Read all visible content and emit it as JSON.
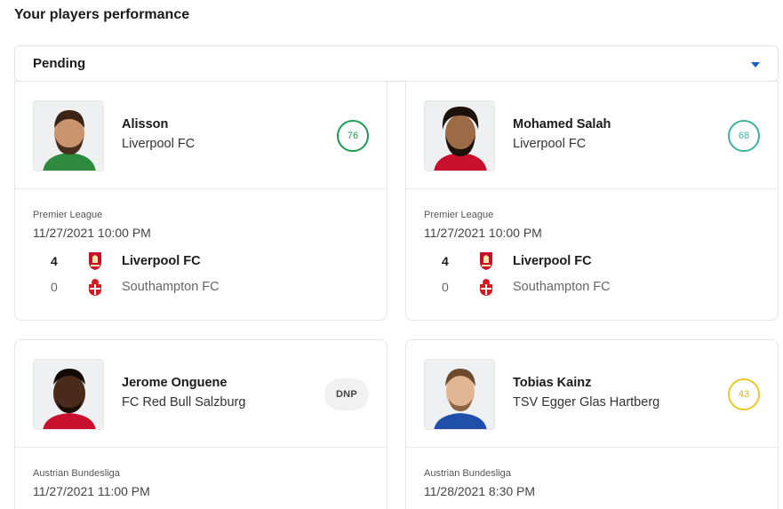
{
  "header": {
    "title": "Your players performance"
  },
  "filter": {
    "selected": "Pending"
  },
  "cards": [
    {
      "player": "Alisson",
      "club": "Liverpool FC",
      "score": "76",
      "league": "Premier League",
      "datetime": "11/27/2021 10:00 PM",
      "home": {
        "goals": "4",
        "team": "Liverpool FC"
      },
      "away": {
        "goals": "0",
        "team": "Southampton FC"
      }
    },
    {
      "player": "Mohamed Salah",
      "club": "Liverpool FC",
      "score": "68",
      "league": "Premier League",
      "datetime": "11/27/2021 10:00 PM",
      "home": {
        "goals": "4",
        "team": "Liverpool FC"
      },
      "away": {
        "goals": "0",
        "team": "Southampton FC"
      }
    },
    {
      "player": "Jerome Onguene",
      "club": "FC Red Bull Salzburg",
      "badge": "DNP",
      "league": "Austrian Bundesliga",
      "datetime": "11/27/2021 11:00 PM"
    },
    {
      "player": "Tobias Kainz",
      "club": "TSV Egger Glas Hartberg",
      "score": "43",
      "league": "Austrian Bundesliga",
      "datetime": "11/28/2021 8:30 PM"
    }
  ],
  "colors": {
    "score_high": "#1a9c4f",
    "score_mid": "#3cb39a",
    "score_low": "#e9c82a",
    "accent": "#1c5fc9"
  }
}
